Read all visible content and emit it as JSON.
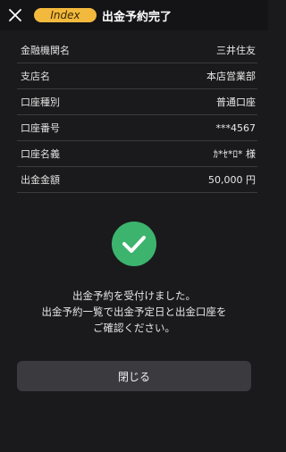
{
  "header": {
    "close_icon": "close-icon",
    "badge": "Index",
    "title": "出金予約完了"
  },
  "details": [
    {
      "label": "金融機関名",
      "value": "三井住友"
    },
    {
      "label": "支店名",
      "value": "本店営業部"
    },
    {
      "label": "口座種別",
      "value": "普通口座"
    },
    {
      "label": "口座番号",
      "value": "***4567"
    },
    {
      "label": "口座名義",
      "value": "ｶ*ｾ*ﾛ* 様"
    },
    {
      "label": "出金金額",
      "value": "50,000 円"
    }
  ],
  "status": {
    "icon": "check-icon",
    "color": "#3cb46e",
    "message_lines": [
      "出金予約を受付けました。",
      "出金予約一覧で出金予定日と出金口座を",
      "ご確認ください。"
    ]
  },
  "actions": {
    "close_label": "閉じる"
  },
  "colors": {
    "background": "#1a1a1c",
    "badge": "#f3b93d",
    "button": "#3a3a3f"
  }
}
